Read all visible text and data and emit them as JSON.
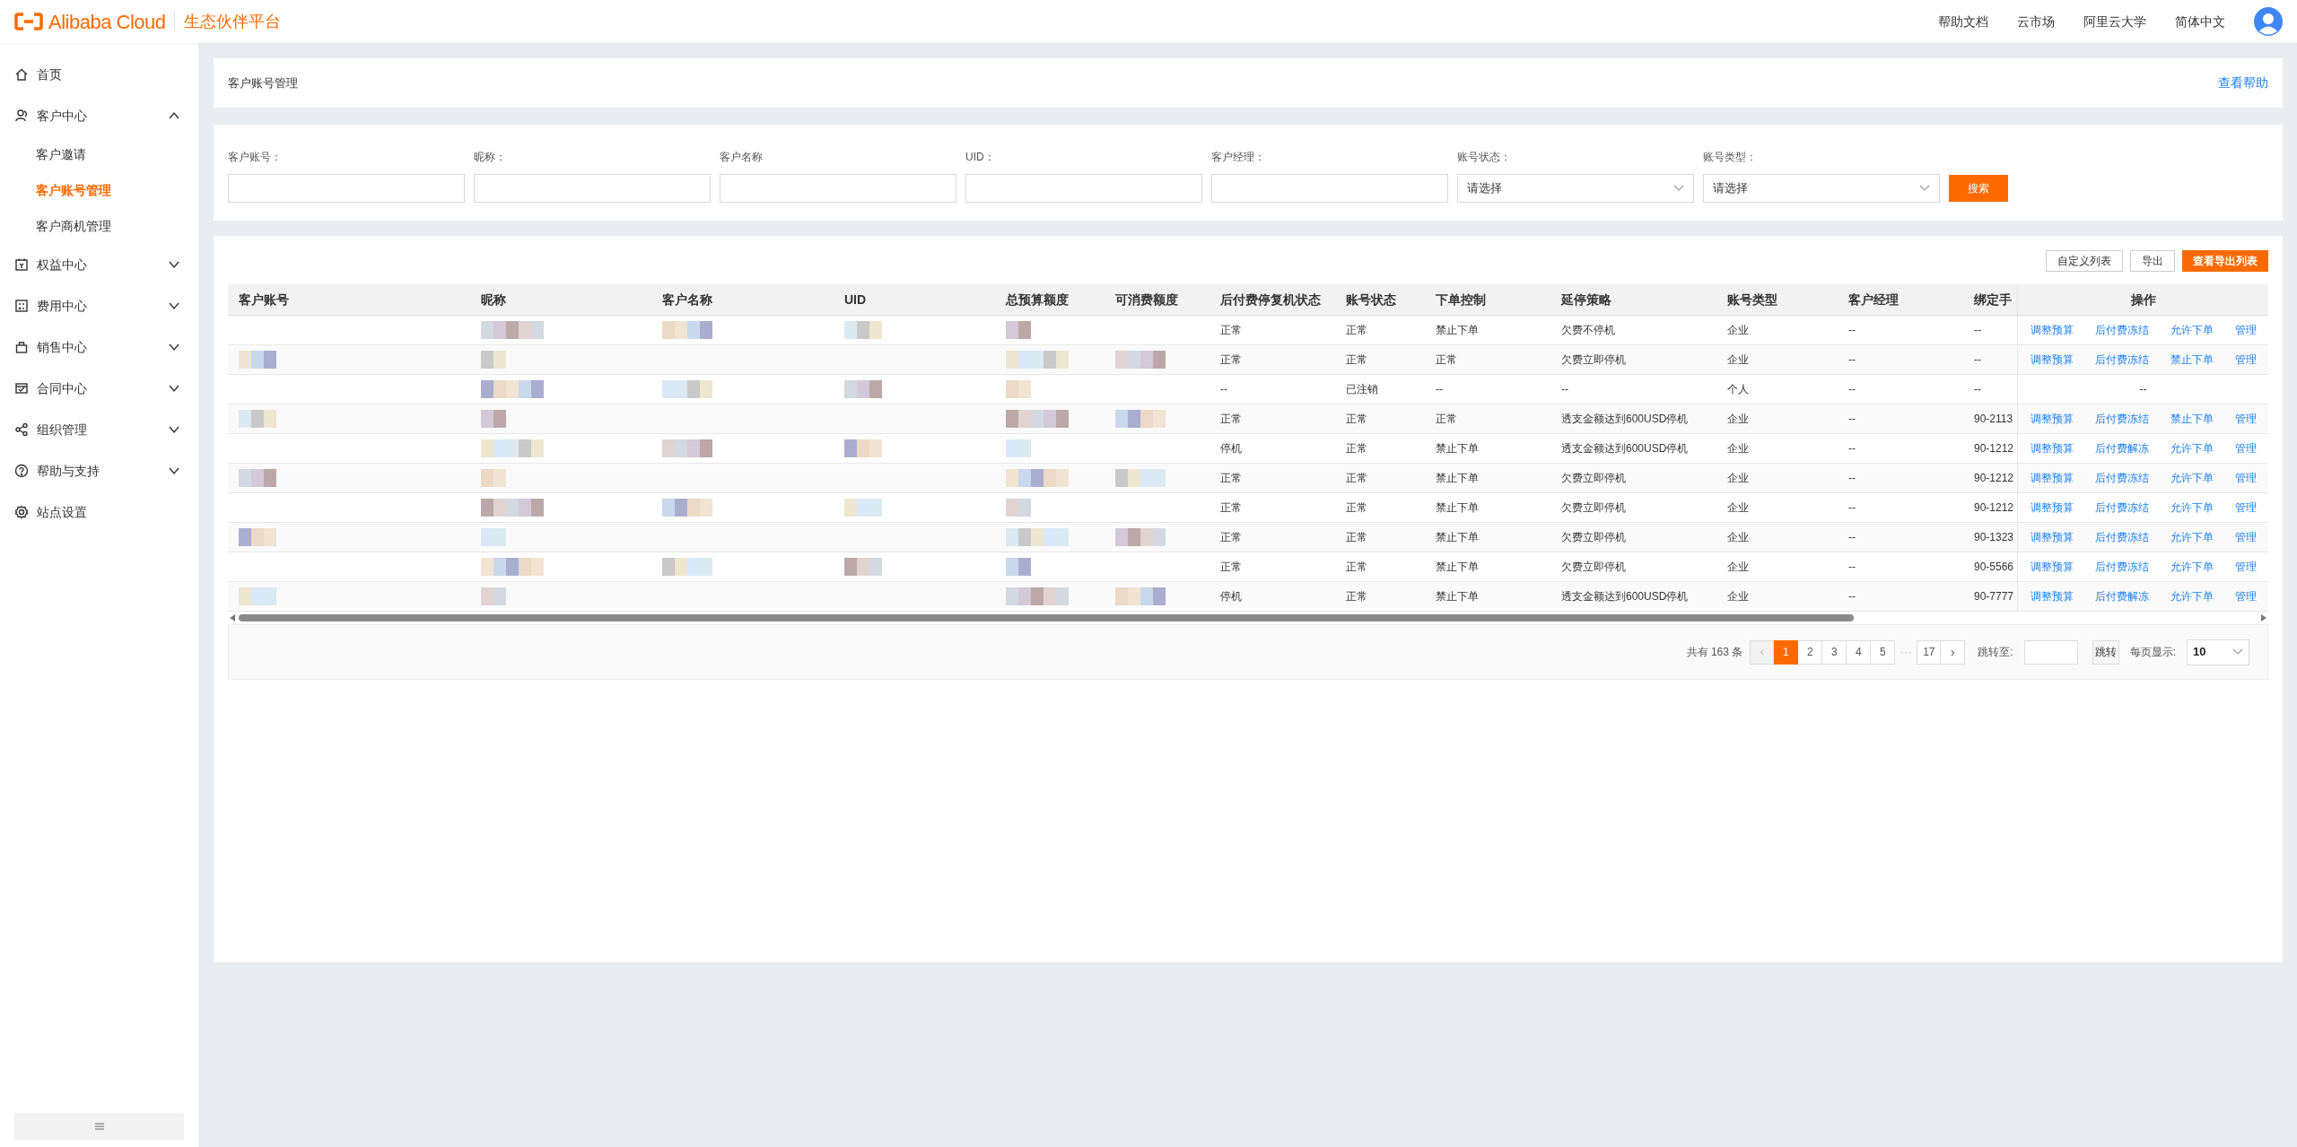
{
  "header": {
    "logo_text": "Alibaba Cloud",
    "platform": "生态伙伴平台",
    "links": [
      "帮助文档",
      "云市场",
      "阿里云大学",
      "简体中文"
    ]
  },
  "sidebar": {
    "items": [
      {
        "label": "首页"
      },
      {
        "label": "客户中心",
        "expanded": true,
        "children": [
          {
            "label": "客户邀请",
            "selected": false
          },
          {
            "label": "客户账号管理",
            "selected": true
          },
          {
            "label": "客户商机管理",
            "selected": false
          }
        ]
      },
      {
        "label": "权益中心",
        "expanded": false
      },
      {
        "label": "费用中心",
        "expanded": false
      },
      {
        "label": "销售中心",
        "expanded": false
      },
      {
        "label": "合同中心",
        "expanded": false
      },
      {
        "label": "组织管理",
        "expanded": false
      },
      {
        "label": "帮助与支持",
        "expanded": false
      },
      {
        "label": "站点设置"
      }
    ]
  },
  "page_title": "客户账号管理",
  "help_link": "查看帮助",
  "filters": [
    {
      "label": "客户账号：",
      "kind": "text"
    },
    {
      "label": "昵称：",
      "kind": "text"
    },
    {
      "label": "客户名称",
      "kind": "text"
    },
    {
      "label": "UID：",
      "kind": "text"
    },
    {
      "label": "客户经理：",
      "kind": "text"
    },
    {
      "label": "账号状态：",
      "kind": "select",
      "placeholder": "请选择"
    },
    {
      "label": "账号类型：",
      "kind": "select",
      "placeholder": "请选择"
    }
  ],
  "search_button": "搜索",
  "toolbar": [
    {
      "label": "自定义列表",
      "kind": "default"
    },
    {
      "label": "导出",
      "kind": "default"
    },
    {
      "label": "查看导出列表",
      "kind": "primary"
    }
  ],
  "table": {
    "columns": [
      "客户账号",
      "昵称",
      "客户名称",
      "UID",
      "总预算额度",
      "可消费额度",
      "后付费停复机状态",
      "账号状态",
      "下单控制",
      "延停策略",
      "账号类型",
      "客户经理",
      "绑定手",
      "操作"
    ],
    "rows": [
      {
        "cells": [
          "",
          "",
          "",
          "",
          "",
          "",
          "正常",
          "正常",
          "禁止下单",
          "欠费不停机",
          "企业",
          "--",
          "--"
        ],
        "actions": [
          "调整预算",
          "后付费冻结",
          "允许下单",
          "管理"
        ]
      },
      {
        "cells": [
          "",
          "",
          "",
          "",
          "",
          "",
          "正常",
          "正常",
          "正常",
          "欠费立即停机",
          "企业",
          "--",
          "--"
        ],
        "actions": [
          "调整预算",
          "后付费冻结",
          "禁止下单",
          "管理"
        ]
      },
      {
        "cells": [
          "",
          "",
          "",
          "",
          "",
          "",
          "--",
          "已注销",
          "--",
          "--",
          "个人",
          "--",
          "--"
        ],
        "operation_text": "--"
      },
      {
        "cells": [
          "",
          "",
          "",
          "",
          "",
          "",
          "正常",
          "正常",
          "正常",
          "透支金额达到600USD停机",
          "企业",
          "--",
          "90-2113"
        ],
        "actions": [
          "调整预算",
          "后付费冻结",
          "禁止下单",
          "管理"
        ]
      },
      {
        "cells": [
          "",
          "",
          "",
          "",
          "",
          "",
          "停机",
          "正常",
          "禁止下单",
          "透支金额达到600USD停机",
          "企业",
          "--",
          "90-1212"
        ],
        "actions": [
          "调整预算",
          "后付费解冻",
          "允许下单",
          "管理"
        ]
      },
      {
        "cells": [
          "",
          "",
          "",
          "",
          "",
          "",
          "正常",
          "正常",
          "禁止下单",
          "欠费立即停机",
          "企业",
          "--",
          "90-1212"
        ],
        "actions": [
          "调整预算",
          "后付费冻结",
          "允许下单",
          "管理"
        ]
      },
      {
        "cells": [
          "",
          "",
          "",
          "",
          "",
          "",
          "正常",
          "正常",
          "禁止下单",
          "欠费立即停机",
          "企业",
          "--",
          "90-1212"
        ],
        "actions": [
          "调整预算",
          "后付费冻结",
          "允许下单",
          "管理"
        ]
      },
      {
        "cells": [
          "",
          "",
          "",
          "",
          "",
          "",
          "正常",
          "正常",
          "禁止下单",
          "欠费立即停机",
          "企业",
          "--",
          "90-1323"
        ],
        "actions": [
          "调整预算",
          "后付费冻结",
          "允许下单",
          "管理"
        ]
      },
      {
        "cells": [
          "",
          "",
          "",
          "",
          "",
          "",
          "正常",
          "正常",
          "禁止下单",
          "欠费立即停机",
          "企业",
          "--",
          "90-5566"
        ],
        "actions": [
          "调整预算",
          "后付费冻结",
          "允许下单",
          "管理"
        ]
      },
      {
        "cells": [
          "",
          "",
          "",
          "",
          "",
          "",
          "停机",
          "正常",
          "禁止下单",
          "透支金额达到600USD停机",
          "企业",
          "--",
          "90-7777"
        ],
        "actions": [
          "调整预算",
          "后付费解冻",
          "允许下单",
          "管理"
        ]
      }
    ]
  },
  "pagination": {
    "total": "共有 163 条",
    "prev": "‹",
    "pages": [
      {
        "label": "1",
        "selected": true
      },
      {
        "label": "2",
        "selected": false
      },
      {
        "label": "3",
        "selected": false
      },
      {
        "label": "4",
        "selected": false
      },
      {
        "label": "5",
        "selected": false
      }
    ],
    "ellipsis": "···",
    "last": "17",
    "next": "›",
    "jump_label": "跳转至:",
    "jump_button": "跳转",
    "page_size_label": "每页显示:",
    "page_size": "10"
  }
}
